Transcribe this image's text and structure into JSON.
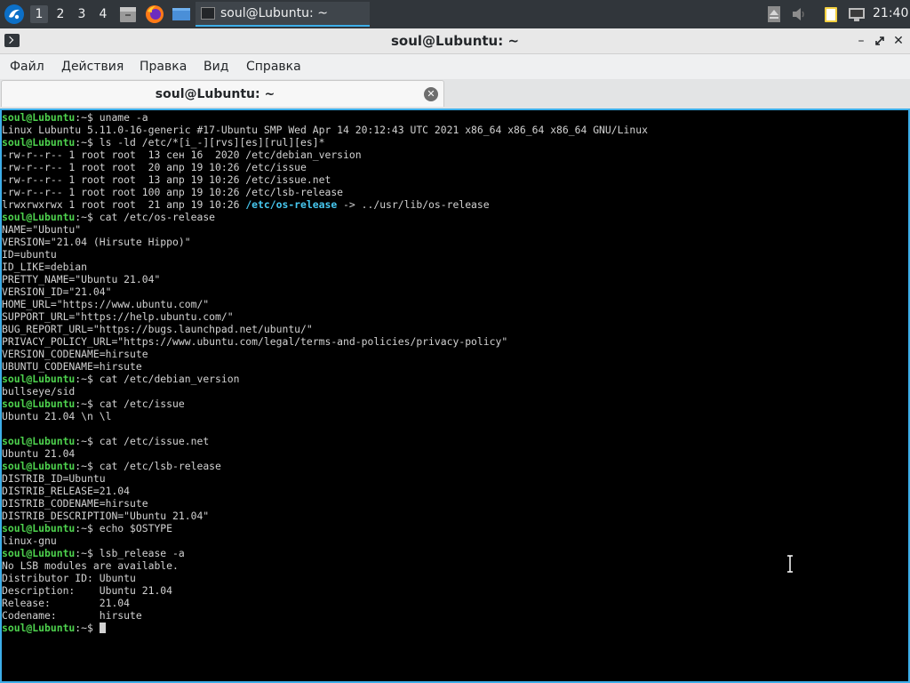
{
  "taskbar": {
    "workspaces": [
      "1",
      "2",
      "3",
      "4"
    ],
    "active_workspace": 0,
    "task_label": "soul@Lubuntu: ~",
    "clock": "21:40"
  },
  "window": {
    "title": "soul@Lubuntu: ~",
    "buttons": {
      "minimize": "–",
      "maximize": "✕",
      "close": "✕"
    }
  },
  "menu": [
    "Файл",
    "Действия",
    "Правка",
    "Вид",
    "Справка"
  ],
  "tab": {
    "title": "soul@Lubuntu: ~",
    "close": "✕"
  },
  "terminal": {
    "prompt": "soul@Lubuntu",
    "prompt_suffix": ":~$",
    "lines": [
      {
        "t": "p",
        "cmd": " uname -a"
      },
      {
        "t": "o",
        "text": "Linux Lubuntu 5.11.0-16-generic #17-Ubuntu SMP Wed Apr 14 20:12:43 UTC 2021 x86_64 x86_64 x86_64 GNU/Linux"
      },
      {
        "t": "p",
        "cmd": " ls -ld /etc/*[i_-][rvs][es][rul][es]*"
      },
      {
        "t": "o",
        "text": "-rw-r--r-- 1 root root  13 сен 16  2020 /etc/debian_version"
      },
      {
        "t": "o",
        "text": "-rw-r--r-- 1 root root  20 апр 19 10:26 /etc/issue"
      },
      {
        "t": "o",
        "text": "-rw-r--r-- 1 root root  13 апр 19 10:26 /etc/issue.net"
      },
      {
        "t": "o",
        "text": "-rw-r--r-- 1 root root 100 апр 19 10:26 /etc/lsb-release"
      },
      {
        "t": "l",
        "pre": "lrwxrwxrwx 1 root root  21 апр 19 10:26 ",
        "link": "/etc/os-release",
        "post": " -> ../usr/lib/os-release"
      },
      {
        "t": "p",
        "cmd": " cat /etc/os-release"
      },
      {
        "t": "o",
        "text": "NAME=\"Ubuntu\""
      },
      {
        "t": "o",
        "text": "VERSION=\"21.04 (Hirsute Hippo)\""
      },
      {
        "t": "o",
        "text": "ID=ubuntu"
      },
      {
        "t": "o",
        "text": "ID_LIKE=debian"
      },
      {
        "t": "o",
        "text": "PRETTY_NAME=\"Ubuntu 21.04\""
      },
      {
        "t": "o",
        "text": "VERSION_ID=\"21.04\""
      },
      {
        "t": "o",
        "text": "HOME_URL=\"https://www.ubuntu.com/\""
      },
      {
        "t": "o",
        "text": "SUPPORT_URL=\"https://help.ubuntu.com/\""
      },
      {
        "t": "o",
        "text": "BUG_REPORT_URL=\"https://bugs.launchpad.net/ubuntu/\""
      },
      {
        "t": "o",
        "text": "PRIVACY_POLICY_URL=\"https://www.ubuntu.com/legal/terms-and-policies/privacy-policy\""
      },
      {
        "t": "o",
        "text": "VERSION_CODENAME=hirsute"
      },
      {
        "t": "o",
        "text": "UBUNTU_CODENAME=hirsute"
      },
      {
        "t": "p",
        "cmd": " cat /etc/debian_version"
      },
      {
        "t": "o",
        "text": "bullseye/sid"
      },
      {
        "t": "p",
        "cmd": " cat /etc/issue"
      },
      {
        "t": "o",
        "text": "Ubuntu 21.04 \\n \\l"
      },
      {
        "t": "o",
        "text": ""
      },
      {
        "t": "p",
        "cmd": " cat /etc/issue.net"
      },
      {
        "t": "o",
        "text": "Ubuntu 21.04"
      },
      {
        "t": "p",
        "cmd": " cat /etc/lsb-release"
      },
      {
        "t": "o",
        "text": "DISTRIB_ID=Ubuntu"
      },
      {
        "t": "o",
        "text": "DISTRIB_RELEASE=21.04"
      },
      {
        "t": "o",
        "text": "DISTRIB_CODENAME=hirsute"
      },
      {
        "t": "o",
        "text": "DISTRIB_DESCRIPTION=\"Ubuntu 21.04\""
      },
      {
        "t": "p",
        "cmd": " echo $OSTYPE"
      },
      {
        "t": "o",
        "text": "linux-gnu"
      },
      {
        "t": "p",
        "cmd": " lsb_release -a"
      },
      {
        "t": "o",
        "text": "No LSB modules are available."
      },
      {
        "t": "o",
        "text": "Distributor ID:\tUbuntu"
      },
      {
        "t": "o",
        "text": "Description:\tUbuntu 21.04"
      },
      {
        "t": "o",
        "text": "Release:\t21.04"
      },
      {
        "t": "o",
        "text": "Codename:\thirsute"
      },
      {
        "t": "c",
        "cmd": " "
      }
    ]
  }
}
